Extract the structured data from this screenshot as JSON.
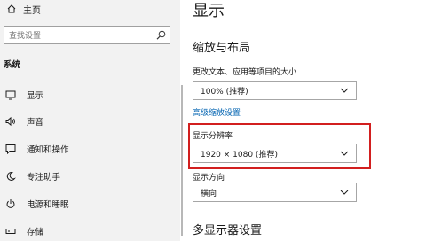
{
  "sidebar": {
    "home_label": "主页",
    "search_placeholder": "查找设置",
    "section_title": "系统",
    "items": [
      {
        "label": "显示",
        "icon": "monitor-icon"
      },
      {
        "label": "声音",
        "icon": "speaker-icon"
      },
      {
        "label": "通知和操作",
        "icon": "notification-icon"
      },
      {
        "label": "专注助手",
        "icon": "moon-icon"
      },
      {
        "label": "电源和睡眠",
        "icon": "power-icon"
      },
      {
        "label": "存储",
        "icon": "storage-icon"
      }
    ]
  },
  "main": {
    "page_title": "显示",
    "scale_section_title": "缩放与布局",
    "scale_label": "更改文本、应用等项目的大小",
    "scale_value": "100% (推荐)",
    "advanced_scaling_link": "高级缩放设置",
    "resolution_label": "显示分辨率",
    "resolution_value": "1920 × 1080 (推荐)",
    "orientation_label": "显示方向",
    "orientation_value": "横向",
    "multi_display_title": "多显示器设置"
  },
  "colors": {
    "highlight_border": "#d21f1f",
    "link": "#0063b1",
    "sidebar_bg": "#f2f2f2"
  }
}
